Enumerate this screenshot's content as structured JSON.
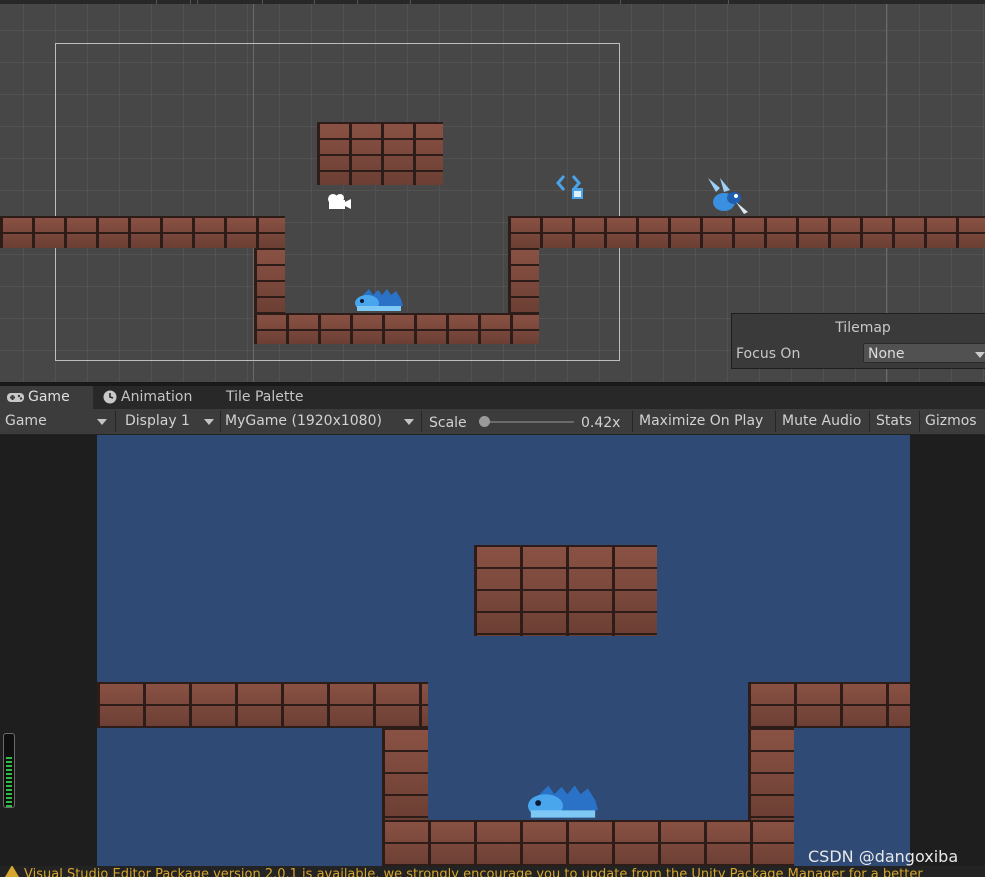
{
  "scene": {
    "tilemap_panel": {
      "title": "Tilemap",
      "focus_label": "Focus On",
      "focus_value": "None"
    }
  },
  "tabs": [
    {
      "label": "Game",
      "icon": "gamepad-icon"
    },
    {
      "label": "Animation",
      "icon": "clock-icon"
    },
    {
      "label": "Tile Palette"
    }
  ],
  "toolbar": {
    "view_select": "Game",
    "display_select": "Display 1",
    "resolution_select": "MyGame (1920x1080)",
    "scale_label": "Scale",
    "scale_value": "0.42x",
    "maximize_label": "Maximize On Play",
    "mute_label": "Mute Audio",
    "stats_label": "Stats",
    "gizmos_label": "Gizmos"
  },
  "colors": {
    "game_background": "#2f4a74",
    "brick": "#7a4a3d",
    "player": "#3a8fe0",
    "warning": "#d6a52d"
  },
  "watermark": "CSDN @dangoxiba",
  "status_text": "Visual Studio Editor Package version 2.0.1 is available, we strongly encourage you to update from the Unity Package Manager for a better"
}
